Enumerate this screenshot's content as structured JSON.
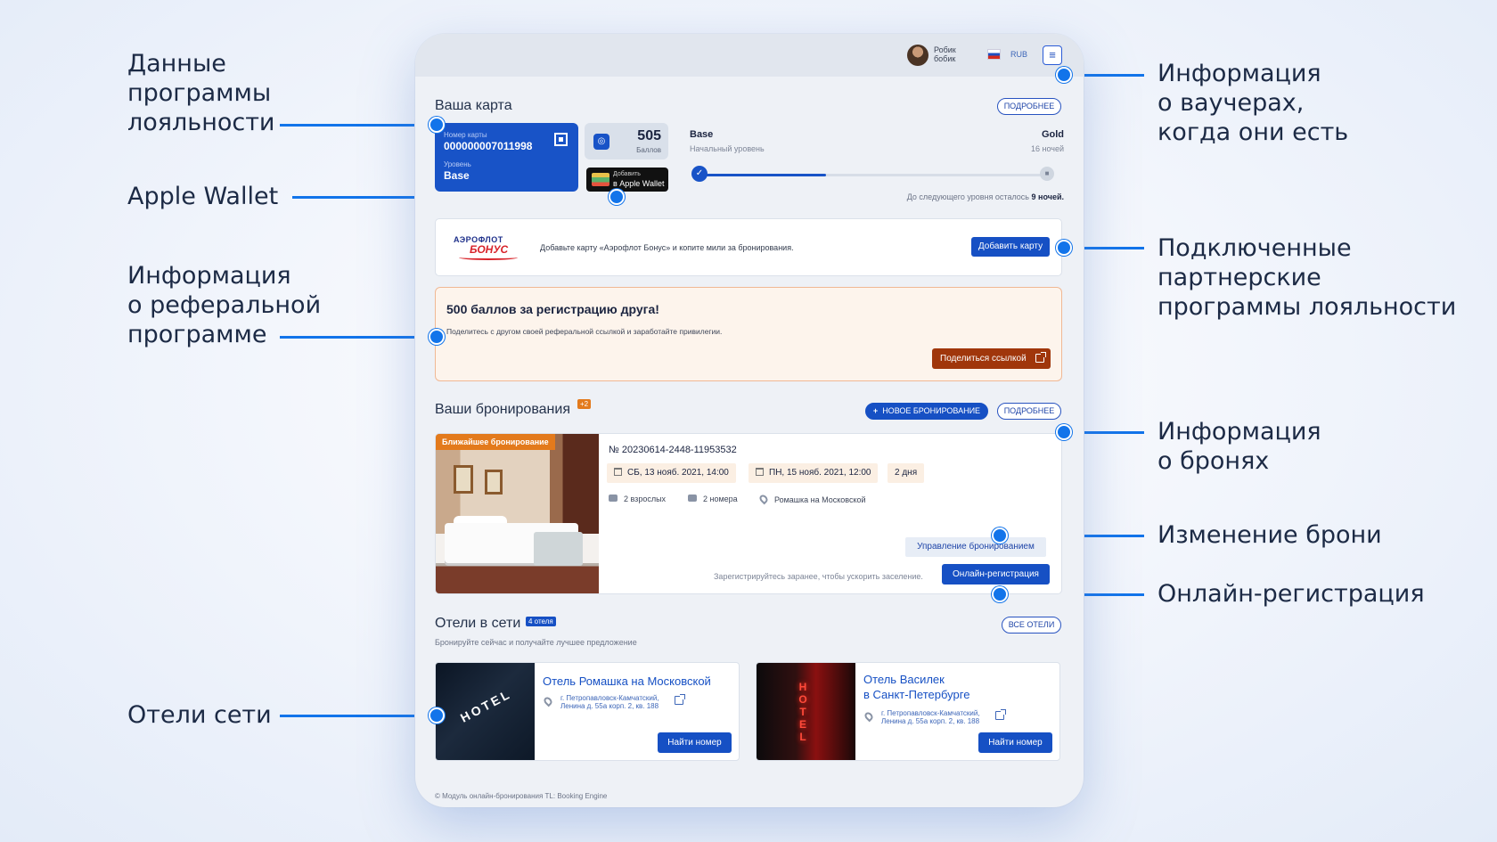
{
  "callouts": {
    "loyalty": "Данные\nпрограммы\nлояльности",
    "wallet": "Apple Wallet",
    "referral": "Информация\nо реферальной\nпрограмме",
    "hotels": "Отели сети",
    "vouchers": "Информация\nо ваучерах,\nкогда они есть",
    "partners": "Подключенные\nпартнерские\nпрограммы лояльности",
    "bookings": "Информация\nо бронях",
    "change": "Изменение брони",
    "checkin": "Онлайн-регистрация"
  },
  "colors": {
    "accent": "#1274ea",
    "primary_button": "#1650c4",
    "referral_button": "#a0360b",
    "badge_orange": "#e37a1c"
  },
  "header": {
    "user_first": "Робик",
    "user_last": "бобик",
    "currency": "RUB",
    "menu_icon": "hamburger-menu-icon",
    "flag_icon": "russia-flag-icon"
  },
  "card_section": {
    "title": "Ваша карта",
    "more": "ПОДРОБНЕЕ",
    "card_number_label": "Номер карты",
    "card_number": "000000007011998",
    "level_label": "Уровень",
    "level": "Base",
    "points_value": "505",
    "points_label": "Баллов",
    "wallet_line1": "Добавить",
    "wallet_line2": "в Apple Wallet",
    "current_level": "Base",
    "current_level_sub": "Начальный уровень",
    "next_level": "Gold",
    "next_level_sub": "16 ночей",
    "progress_fraction": 0.36,
    "remaining_text": "До следующего уровня осталось",
    "remaining_value": "9 ночей."
  },
  "partner": {
    "logo_line1": "АЭРОФЛОТ",
    "logo_line2": "БОНУС",
    "text": "Добавьте карту «Аэрофлот Бонус» и копите мили за бронирования.",
    "button": "Добавить карту"
  },
  "referral": {
    "title": "500 баллов за регистрацию друга!",
    "text": "Поделитесь с другом своей реферальной ссылкой и заработайте привилегии.",
    "button": "Поделиться ссылкой"
  },
  "bookings": {
    "title": "Ваши бронирования",
    "count_badge": "+2",
    "new_button": "НОВОЕ БРОНИРОВАНИЕ",
    "more": "ПОДРОБНЕЕ",
    "nearest_label": "Ближайшее бронирование",
    "number": "№ 20230614-2448-11953532",
    "checkin": "СБ, 13 нояб. 2021, 14:00",
    "checkout": "ПН, 15 нояб. 2021, 12:00",
    "duration": "2 дня",
    "guests": "2 взрослых",
    "rooms": "2 номера",
    "hotel": "Ромашка на Московской",
    "manage_button": "Управление бронированием",
    "early_text": "Зарегистрируйтесь заранее, чтобы ускорить заселение.",
    "checkin_button": "Онлайн-регистрация"
  },
  "hotels": {
    "title": "Отели в сети",
    "count_badge": "4 отеля",
    "subtitle": "Бронируйте сейчас и получайте лучшее предложение",
    "all_button": "ВСЕ ОТЕЛИ",
    "items": [
      {
        "name": "Отель Ромашка на Московской",
        "addr1": "г. Петропавловск-Камчатский,",
        "addr2": "Ленина д. 55а корп. 2, кв. 188",
        "button": "Найти номер",
        "sign": "HOTEL"
      },
      {
        "name_line1": "Отель Василек",
        "name_line2": "в Санкт-Петербурге",
        "addr1": "г. Петропавловск-Камчатский,",
        "addr2": "Ленина д. 55а корп. 2, кв. 188",
        "button": "Найти номер",
        "sign": "HOTEL"
      }
    ]
  },
  "footer": "© Модуль онлайн-бронирования TL: Booking Engine"
}
